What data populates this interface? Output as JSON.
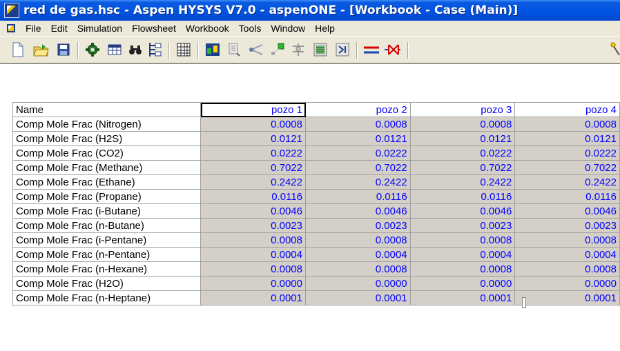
{
  "window": {
    "title": "red de gas.hsc - Aspen HYSYS V7.0 - aspenONE - [Workbook - Case (Main)]"
  },
  "menubar": {
    "items": [
      "File",
      "Edit",
      "Simulation",
      "Flowsheet",
      "Workbook",
      "Tools",
      "Window",
      "Help"
    ]
  },
  "toolbar": {
    "buttons": [
      "new-document-icon",
      "open-folder-icon",
      "save-icon",
      "case-component-icon",
      "workbook-icon",
      "find-binoculars-icon",
      "object-navigator-icon",
      "grid-icon",
      "pfd-icon",
      "stream-icon",
      "pipe-icon",
      "node-icon",
      "recycle-icon",
      "stat-icon",
      "spreadsheet-icon",
      "stream-line-icon",
      "valve-icon",
      "extra-tool-icon"
    ]
  },
  "workbook": {
    "header": {
      "name": "Name",
      "columns": [
        "pozo 1",
        "pozo 2",
        "pozo 3",
        "pozo 4"
      ]
    },
    "rows": [
      {
        "name": "Comp Mole Frac (Nitrogen)",
        "values": [
          "0.0008",
          "0.0008",
          "0.0008",
          "0.0008"
        ]
      },
      {
        "name": "Comp Mole Frac (H2S)",
        "values": [
          "0.0121",
          "0.0121",
          "0.0121",
          "0.0121"
        ]
      },
      {
        "name": "Comp Mole Frac (CO2)",
        "values": [
          "0.0222",
          "0.0222",
          "0.0222",
          "0.0222"
        ]
      },
      {
        "name": "Comp Mole Frac (Methane)",
        "values": [
          "0.7022",
          "0.7022",
          "0.7022",
          "0.7022"
        ]
      },
      {
        "name": "Comp Mole Frac (Ethane)",
        "values": [
          "0.2422",
          "0.2422",
          "0.2422",
          "0.2422"
        ]
      },
      {
        "name": "Comp Mole Frac (Propane)",
        "values": [
          "0.0116",
          "0.0116",
          "0.0116",
          "0.0116"
        ]
      },
      {
        "name": "Comp Mole Frac (i-Butane)",
        "values": [
          "0.0046",
          "0.0046",
          "0.0046",
          "0.0046"
        ]
      },
      {
        "name": "Comp Mole Frac (n-Butane)",
        "values": [
          "0.0023",
          "0.0023",
          "0.0023",
          "0.0023"
        ]
      },
      {
        "name": "Comp Mole Frac (i-Pentane)",
        "values": [
          "0.0008",
          "0.0008",
          "0.0008",
          "0.0008"
        ]
      },
      {
        "name": "Comp Mole Frac (n-Pentane)",
        "values": [
          "0.0004",
          "0.0004",
          "0.0004",
          "0.0004"
        ]
      },
      {
        "name": "Comp Mole Frac (n-Hexane)",
        "values": [
          "0.0008",
          "0.0008",
          "0.0008",
          "0.0008"
        ]
      },
      {
        "name": "Comp Mole Frac (H2O)",
        "values": [
          "0.0000",
          "0.0000",
          "0.0000",
          "0.0000"
        ]
      },
      {
        "name": "Comp Mole Frac (n-Heptane)",
        "values": [
          "0.0001",
          "0.0001",
          "0.0001",
          "0.0001"
        ]
      }
    ]
  }
}
